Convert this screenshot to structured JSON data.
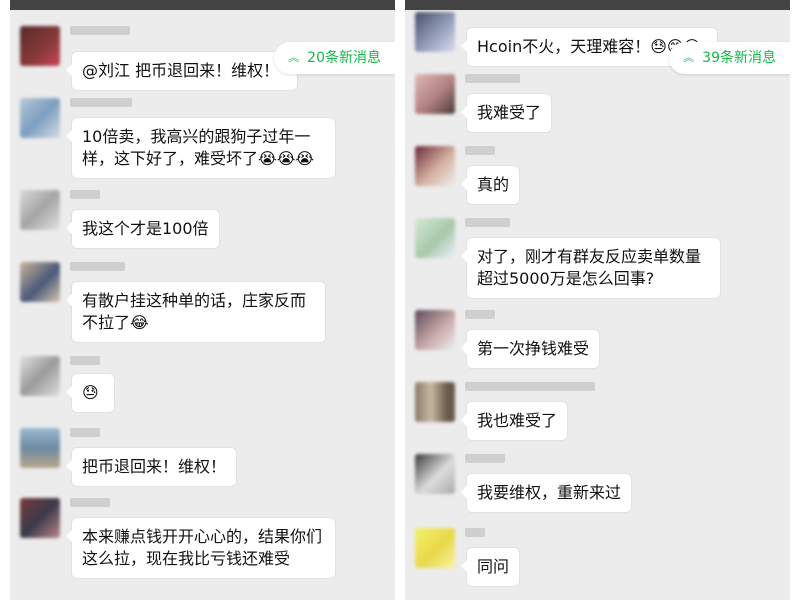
{
  "left": {
    "new_messages": "20条新消息",
    "messages": [
      {
        "text": "@刘江 把币退回来！维权！"
      },
      {
        "text": "10倍卖，我高兴的跟狗子过年一样，这下好了，难受坏了😭😭😭"
      },
      {
        "text": "我这个才是100倍"
      },
      {
        "text": "有散户挂这种单的话，庄家反而不拉了😂"
      },
      {
        "text": "😓"
      },
      {
        "text": "把币退回来！维权！"
      },
      {
        "text": "本来赚点钱开开心心的，结果你们这么拉，现在我比亏钱还难受"
      }
    ]
  },
  "right": {
    "new_messages": "39条新消息",
    "messages": [
      {
        "text": "Hcoin不火，天理难容！😓😊😊"
      },
      {
        "text": "我难受了"
      },
      {
        "text": "真的"
      },
      {
        "text": "对了，刚才有群友反应卖单数量超过5000万是怎么回事?"
      },
      {
        "text": "第一次挣钱难受"
      },
      {
        "text": "我也难受了"
      },
      {
        "text": "我要维权，重新来过"
      },
      {
        "text": "同问"
      }
    ]
  },
  "colors": {
    "accent": "#17b84a",
    "chat_bg": "#ececec",
    "bubble": "#ffffff"
  }
}
